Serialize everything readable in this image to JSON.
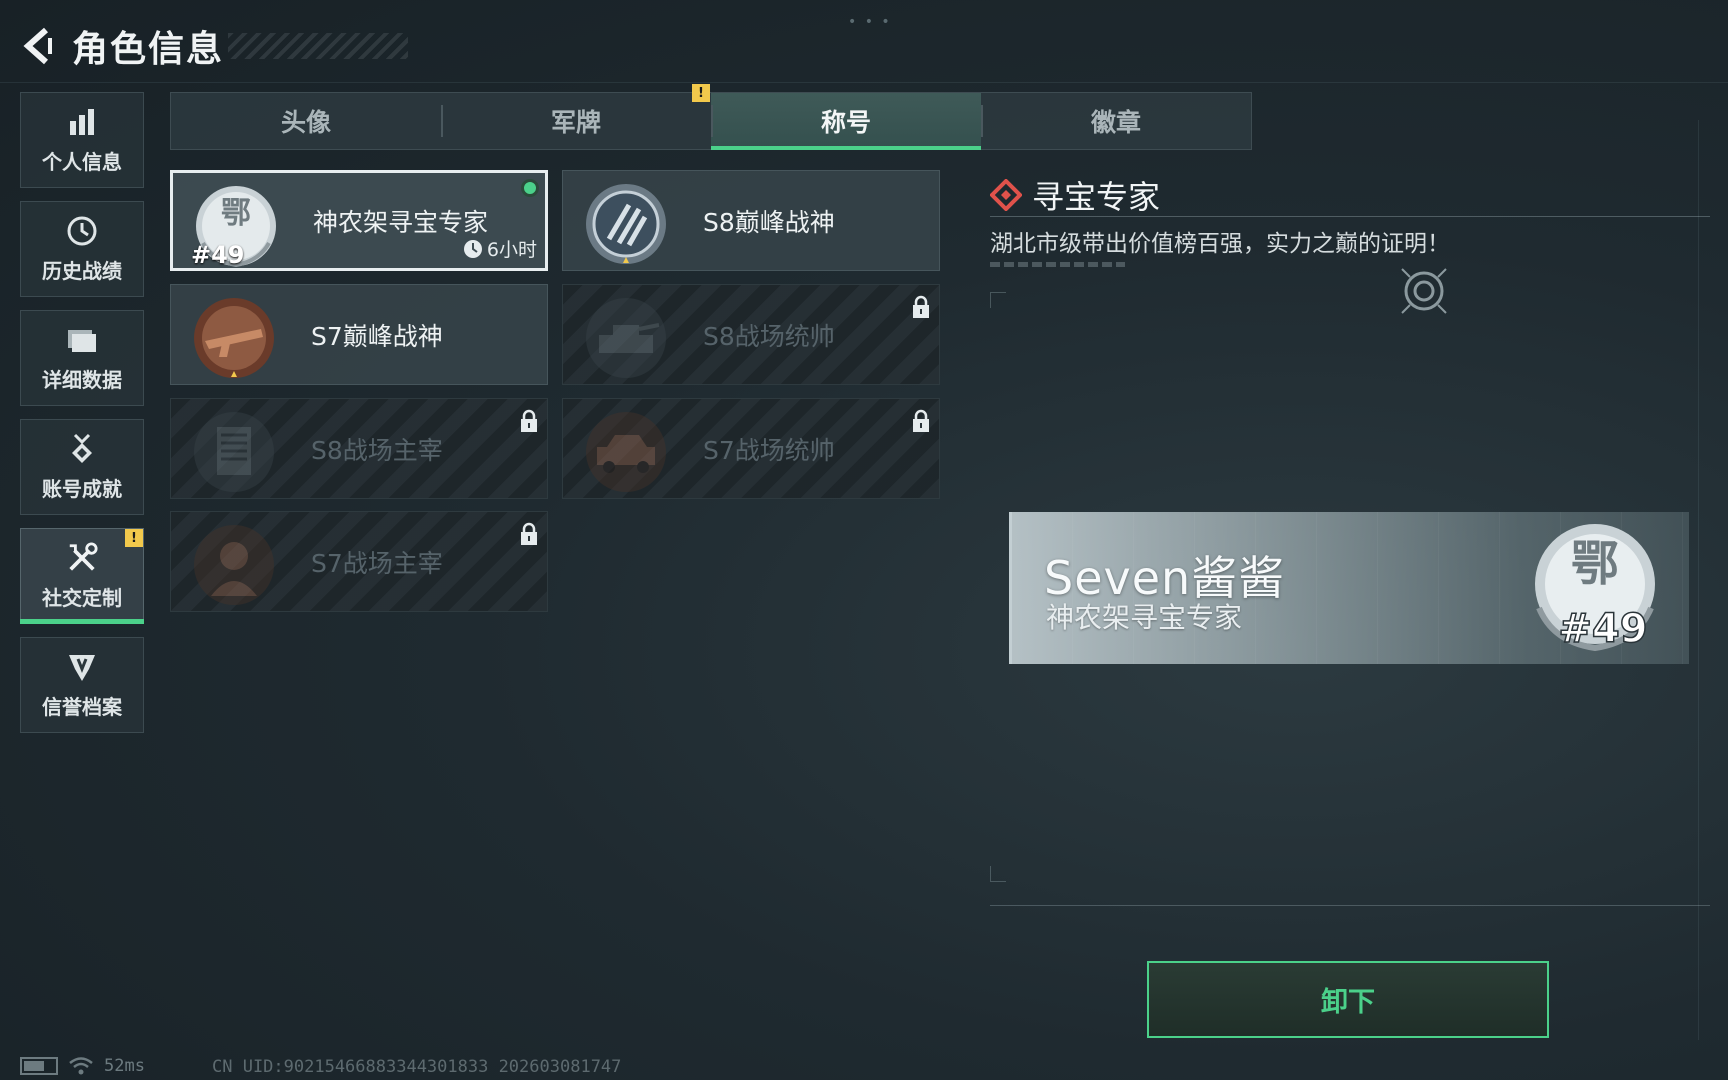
{
  "header": {
    "title": "角色信息"
  },
  "sidebar": {
    "items": [
      {
        "label": "个人信息",
        "icon": "bar-chart-icon",
        "active": false
      },
      {
        "label": "历史战绩",
        "icon": "history-icon",
        "active": false
      },
      {
        "label": "详细数据",
        "icon": "folder-icon",
        "active": false
      },
      {
        "label": "账号成就",
        "icon": "medal-icon",
        "active": false
      },
      {
        "label": "社交定制",
        "icon": "tools-icon",
        "active": true,
        "badge": "!"
      },
      {
        "label": "信誉档案",
        "icon": "shield-icon",
        "active": false
      }
    ]
  },
  "tabs": {
    "items": [
      {
        "label": "头像",
        "active": false
      },
      {
        "label": "军牌",
        "active": false
      },
      {
        "label": "称号",
        "active": true
      },
      {
        "label": "徽章",
        "active": false
      }
    ],
    "badge": "!"
  },
  "titles": [
    {
      "name": "神农架寻宝专家",
      "emblem_text": "鄂",
      "rank": "#49",
      "timer": "6小时",
      "selected": true,
      "equipped": true,
      "locked": false
    },
    {
      "name": "S8巅峰战神",
      "selected": false,
      "locked": false
    },
    {
      "name": "S7巅峰战神",
      "selected": false,
      "locked": false
    },
    {
      "name": "S8战场统帅",
      "selected": false,
      "locked": true
    },
    {
      "name": "S8战场主宰",
      "selected": false,
      "locked": true
    },
    {
      "name": "S7战场统帅",
      "selected": false,
      "locked": true
    },
    {
      "name": "S7战场主宰",
      "selected": false,
      "locked": true
    }
  ],
  "detail": {
    "title": "寻宝专家",
    "description": "湖北市级带出价值榜百强，实力之巅的证明！"
  },
  "nameplate": {
    "player_name": "Seven酱酱",
    "title": "神农架寻宝专家",
    "emblem_text": "鄂",
    "rank": "#49"
  },
  "actions": {
    "unequip_label": "卸下"
  },
  "status": {
    "ping": "52ms",
    "uid": "CN UID:902154668833443018​33 202603081747"
  },
  "colors": {
    "accent": "#4bd18a",
    "warning": "#f2c94c",
    "diamond": "#e0524b"
  }
}
